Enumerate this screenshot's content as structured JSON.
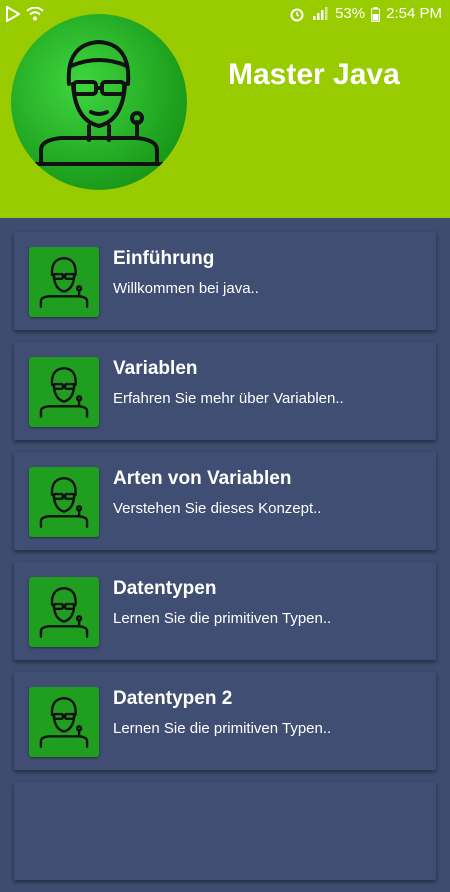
{
  "status_bar": {
    "battery": "53%",
    "time": "2:54 PM"
  },
  "header": {
    "title": "Master Java",
    "background": "#99cc00"
  },
  "lessons": [
    {
      "title": "Einführung",
      "subtitle": "Willkommen bei java.."
    },
    {
      "title": "Variablen",
      "subtitle": "Erfahren Sie mehr über Variablen.."
    },
    {
      "title": "Arten von Variablen",
      "subtitle": "Verstehen Sie dieses Konzept.."
    },
    {
      "title": "Datentypen",
      "subtitle": "Lernen Sie die primitiven Typen.."
    },
    {
      "title": "Datentypen 2",
      "subtitle": "Lernen Sie die primitiven Typen.."
    }
  ],
  "icons": {
    "avatar": "speaker-avatar-icon",
    "status_left": [
      "play-icon",
      "wifi-icon"
    ],
    "status_right": [
      "alarm-icon",
      "signal-icon",
      "battery-icon"
    ]
  }
}
